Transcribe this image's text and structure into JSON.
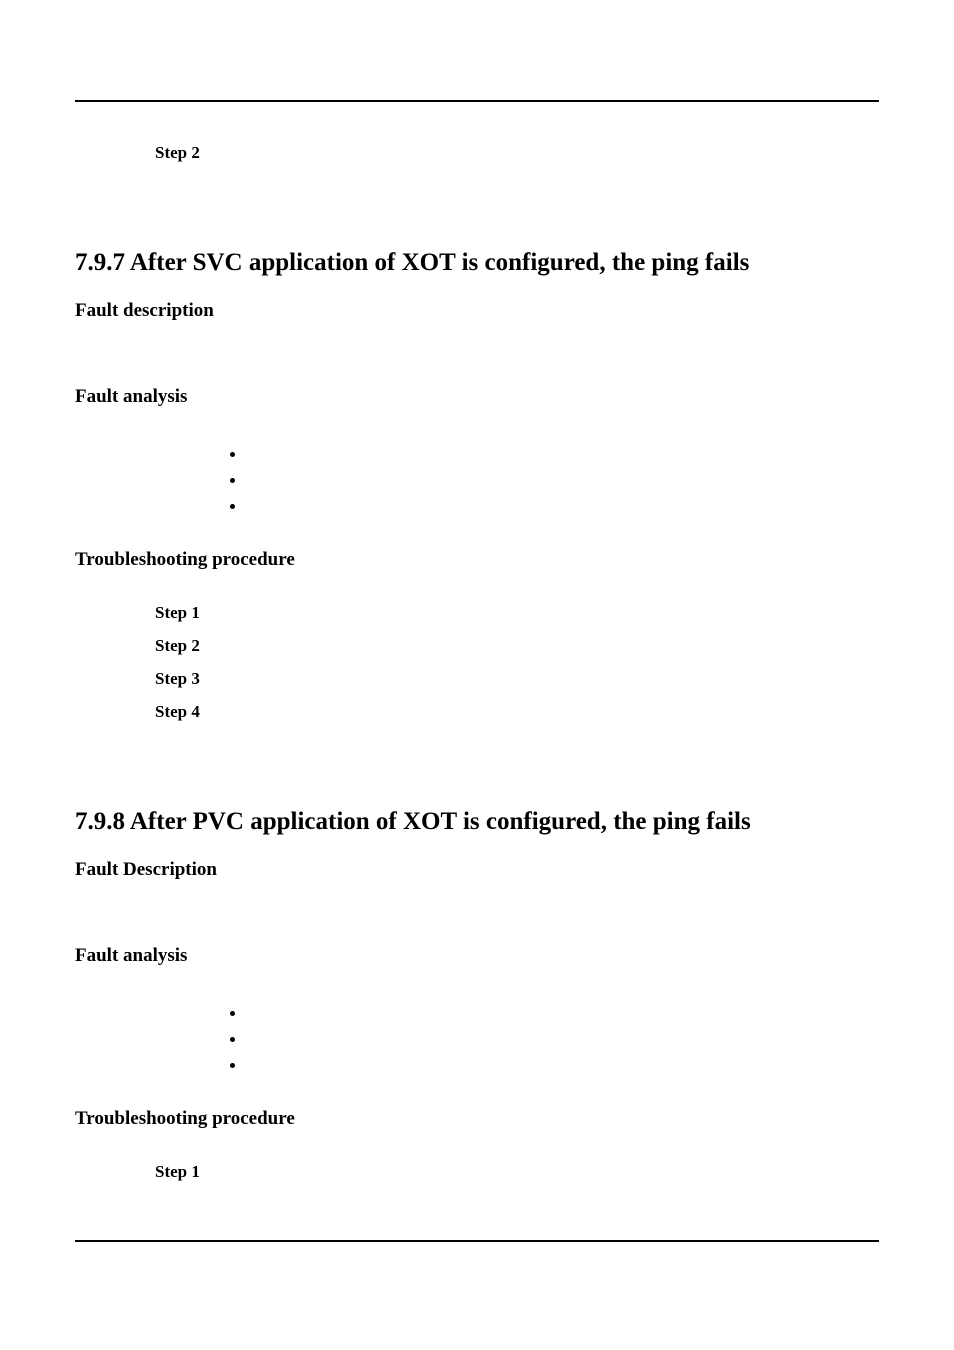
{
  "top_step": "Step 2",
  "section_797": {
    "title": "7.9.7 After SVC application of XOT is configured, the ping fails",
    "fault_desc_hdr": "Fault description",
    "fault_analysis_hdr": "Fault analysis",
    "bullets": [
      "",
      "",
      ""
    ],
    "troubleshoot_hdr": "Troubleshooting procedure",
    "steps": [
      "Step 1",
      "Step 2",
      "Step 3",
      "Step 4"
    ]
  },
  "section_798": {
    "title": "7.9.8 After PVC application of XOT is configured, the ping fails",
    "fault_desc_hdr": "Fault Description",
    "fault_analysis_hdr": "Fault analysis",
    "bullets": [
      "",
      "",
      ""
    ],
    "troubleshoot_hdr": "Troubleshooting procedure",
    "steps": [
      "Step 1"
    ]
  }
}
